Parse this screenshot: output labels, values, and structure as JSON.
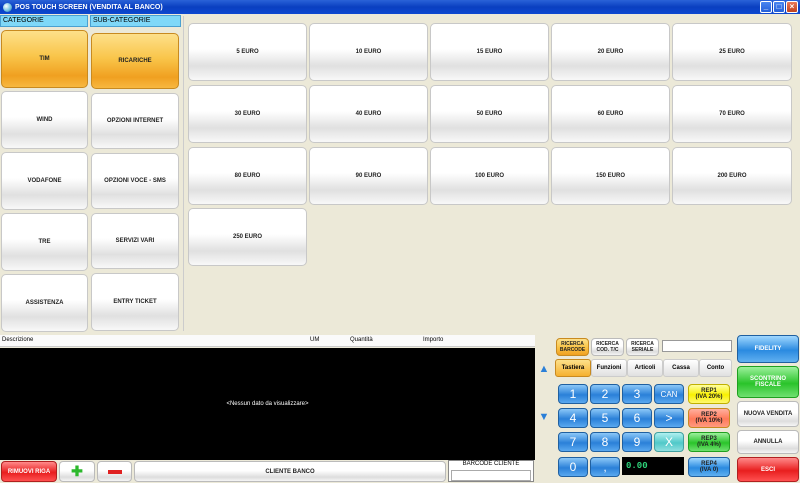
{
  "window": {
    "title": "POS TOUCH SCREEN (VENDITA AL BANCO)"
  },
  "headers": {
    "categorie": "CATEGORIE",
    "sub_categorie": "SUB-CATEGORIE"
  },
  "categories": [
    "TIM",
    "WIND",
    "VODAFONE",
    "TRE",
    "ASSISTENZA"
  ],
  "subcategories": [
    "RICARICHE",
    "OPZIONI INTERNET",
    "OPZIONI VOCE -  SMS",
    "SERVIZI VARI",
    "ENTRY TICKET"
  ],
  "products": [
    "5 EURO",
    "10 EURO",
    "15 EURO",
    "20 EURO",
    "25 EURO",
    "30 EURO",
    "40 EURO",
    "50 EURO",
    "60 EURO",
    "70 EURO",
    "80 EURO",
    "90 EURO",
    "100 EURO",
    "150 EURO",
    "200 EURO",
    "250 EURO"
  ],
  "grid": {
    "columns": {
      "descrizione": "Descrizione",
      "um": "UM",
      "quantita": "Quantità",
      "importo": "Importo"
    },
    "empty_message": "<Nessun dato da visualizzare>"
  },
  "bottom_bar": {
    "rimuovi": "RIMUOVI RIGA",
    "cliente": "CLIENTE BANCO",
    "barcode_cliente": "BARCODE  CLIENTE"
  },
  "search_buttons": [
    {
      "l1": "RICERCA",
      "l2": "BARCODE"
    },
    {
      "l1": "RICERCA",
      "l2": "COD. T/C"
    },
    {
      "l1": "RICERCA",
      "l2": "SERIALE"
    }
  ],
  "tabs": [
    "Tastiera",
    "Funzioni",
    "Articoli",
    "Cassa",
    "Conto"
  ],
  "keypad": {
    "keys": [
      "1",
      "2",
      "3",
      "4",
      "5",
      "6",
      "7",
      "8",
      "9",
      "0",
      ","
    ],
    "can": "CAN",
    "next": ">",
    "clear": "X",
    "display": "0.00"
  },
  "reparti": [
    {
      "l1": "REP1",
      "l2": "(IVA 20%)"
    },
    {
      "l1": "REP2",
      "l2": "(IVA 10%)"
    },
    {
      "l1": "REP3",
      "l2": "(IVA 4%)"
    },
    {
      "l1": "REP4",
      "l2": "(IVA 0)"
    }
  ],
  "actions": {
    "fidelity": "FIDELITY",
    "scontrino_l1": "SCONTRINO",
    "scontrino_l2": "FISCALE",
    "nuova_vendita": "NUOVA VENDITA",
    "annulla": "ANNULLA",
    "esci": "ESCI"
  }
}
